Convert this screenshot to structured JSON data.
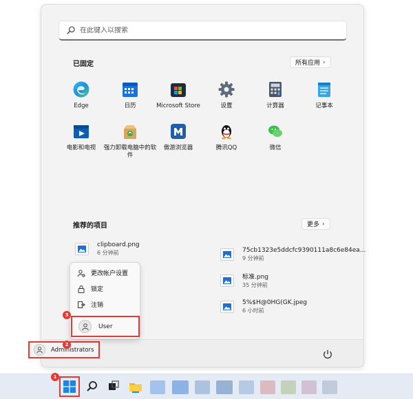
{
  "search": {
    "placeholder": "在此键入以搜索"
  },
  "pinned": {
    "title": "已固定",
    "all_apps_label": "所有应用",
    "apps": [
      {
        "label": "Edge",
        "icon": "edge-icon"
      },
      {
        "label": "日历",
        "icon": "calendar-icon"
      },
      {
        "label": "Microsoft Store",
        "icon": "store-icon"
      },
      {
        "label": "设置",
        "icon": "gear-icon"
      },
      {
        "label": "计算器",
        "icon": "calculator-icon"
      },
      {
        "label": "记事本",
        "icon": "notepad-icon"
      },
      {
        "label": "电影和电视",
        "icon": "movies-icon"
      },
      {
        "label": "强力卸载电脑中的软件",
        "icon": "uninstall-icon"
      },
      {
        "label": "傲游浏览器",
        "icon": "maxthon-icon"
      },
      {
        "label": "腾讯QQ",
        "icon": "qq-icon"
      },
      {
        "label": "微信",
        "icon": "wechat-icon"
      }
    ]
  },
  "recommended": {
    "title": "推荐的项目",
    "more_label": "更多",
    "items": [
      {
        "name": "clipboard.png",
        "time": "6 分钟前"
      },
      {
        "name": "75cb1323e5ddcfc9390111a8c6e84ea...",
        "time": "9 分钟前"
      },
      {
        "name": "标准.png",
        "time": "35 分钟前"
      },
      {
        "name": "5%$H@0HG(GK.jpeg",
        "time": "6 小时前"
      }
    ]
  },
  "account_menu": {
    "change_settings": "更改帐户设置",
    "lock": "锁定",
    "sign_out": "注销",
    "other_user": "User"
  },
  "current_user": "Administrators",
  "badges": {
    "start": "1",
    "admin": "2",
    "user": "3"
  },
  "colors": {
    "highlight": "#e53935",
    "accent": "#0078d4"
  }
}
